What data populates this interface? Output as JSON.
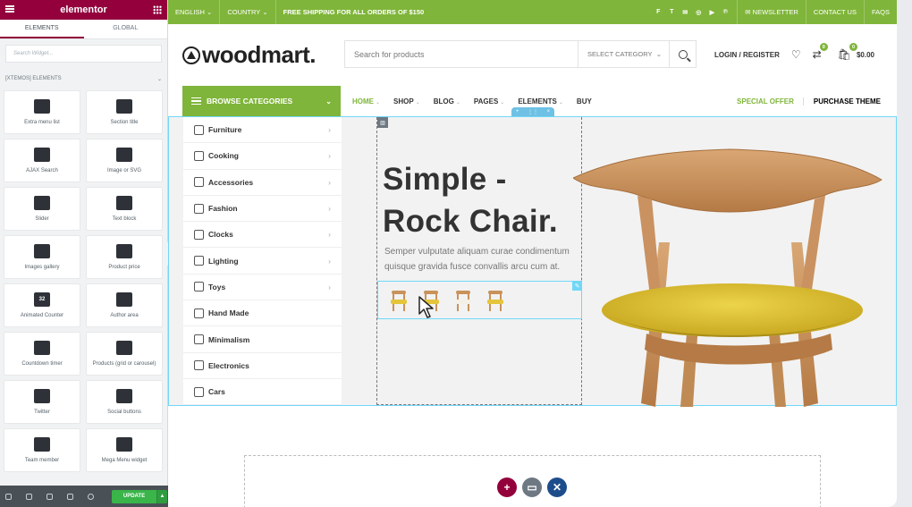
{
  "panel": {
    "brand": "elementor",
    "tabs": [
      "ELEMENTS",
      "GLOBAL"
    ],
    "search_placeholder": "Search Widget...",
    "category": "[XTEMOS] ELEMENTS",
    "widgets": [
      {
        "label": "Extra menu list",
        "icon": "menu-list-icon"
      },
      {
        "label": "Section title",
        "icon": "section-title-icon"
      },
      {
        "label": "AJAX Search",
        "icon": "search-icon"
      },
      {
        "label": "Image or SVG",
        "icon": "image-icon"
      },
      {
        "label": "Slider",
        "icon": "slider-icon"
      },
      {
        "label": "Text block",
        "icon": "text-block-icon"
      },
      {
        "label": "Images gallery",
        "icon": "gallery-icon"
      },
      {
        "label": "Product price",
        "icon": "price-icon"
      },
      {
        "label": "Animated Counter",
        "icon": "counter-icon",
        "glyph": "32"
      },
      {
        "label": "Author area",
        "icon": "author-icon"
      },
      {
        "label": "Countdown timer",
        "icon": "timer-icon"
      },
      {
        "label": "Products (grid or carousel)",
        "icon": "products-icon"
      },
      {
        "label": "Twitter",
        "icon": "twitter-icon"
      },
      {
        "label": "Social buttons",
        "icon": "share-icon"
      },
      {
        "label": "Team member",
        "icon": "team-icon"
      },
      {
        "label": "Mega Menu widget",
        "icon": "mega-menu-icon"
      }
    ],
    "update_label": "UPDATE"
  },
  "topbar": {
    "language": "ENGLISH",
    "country": "COUNTRY",
    "shipping": "FREE SHIPPING FOR ALL ORDERS OF $150",
    "newsletter": "NEWSLETTER",
    "contact": "CONTACT US",
    "faqs": "FAQS",
    "socials": [
      "facebook-icon",
      "twitter-icon",
      "email-icon",
      "instagram-icon",
      "youtube-icon",
      "pinterest-icon"
    ]
  },
  "header": {
    "logo": "woodmart.",
    "search_placeholder": "Search for products",
    "category_select": "SELECT CATEGORY",
    "login": "LOGIN / REGISTER",
    "compare_count": "0",
    "cart_count": "0",
    "cart_total": "$0.00"
  },
  "nav": {
    "browse": "BROWSE CATEGORIES",
    "items": [
      "HOME",
      "SHOP",
      "BLOG",
      "PAGES",
      "ELEMENTS",
      "BUY"
    ],
    "special": "SPECIAL OFFER",
    "purchase": "PURCHASE THEME"
  },
  "categories": [
    "Furniture",
    "Cooking",
    "Accessories",
    "Fashion",
    "Clocks",
    "Lighting",
    "Toys",
    "Hand Made",
    "Minimalism",
    "Electronics",
    "Cars"
  ],
  "hero": {
    "title_line1": "Simple -",
    "title_line2": "Rock Chair.",
    "subtitle": "Semper vulputate aliquam curae condimentum quisque gravida fusce convallis arcu cum at."
  },
  "colors": {
    "accent": "#7fb53a",
    "elementor": "#93003c",
    "selection": "#71d7f7"
  }
}
